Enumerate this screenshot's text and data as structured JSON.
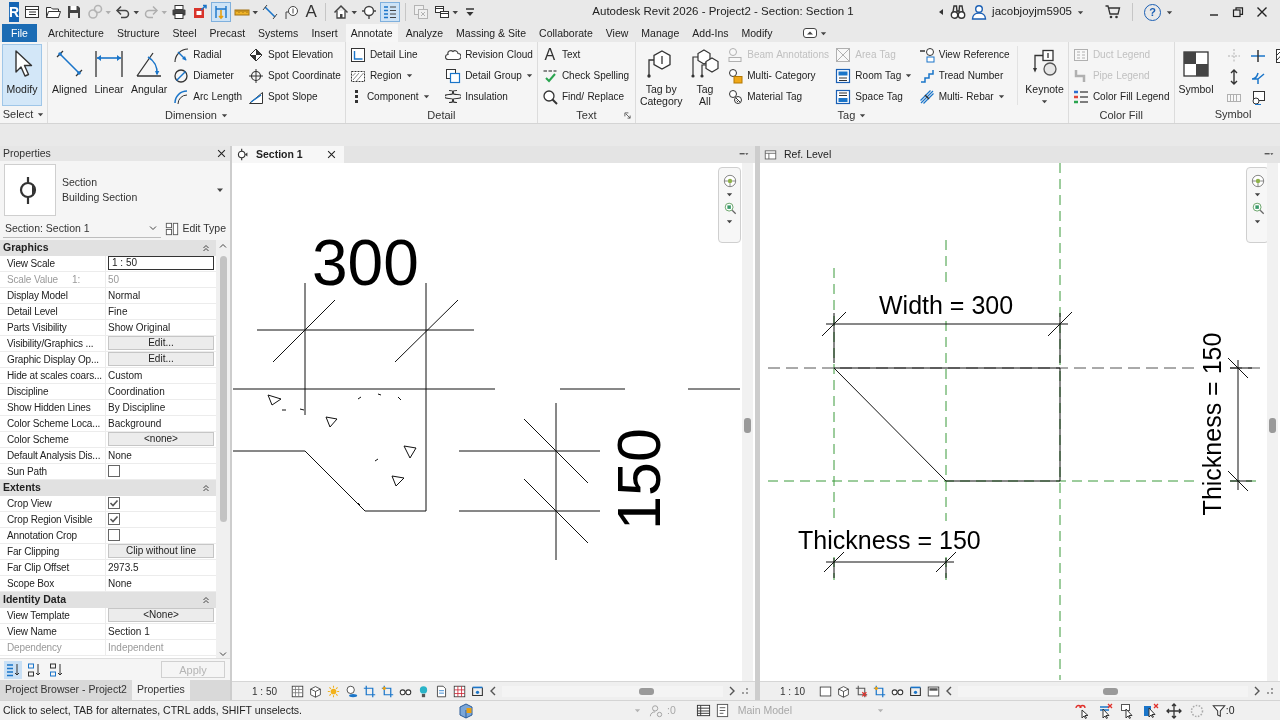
{
  "title_bar": {
    "logo": "R",
    "title": "Autodesk Revit 2026 - Project2 - Section: Section 1",
    "user": "jacobjoyjm5905",
    "help": "?"
  },
  "quick_access": {
    "tools": [
      {
        "selected": false,
        "disabled": false,
        "dropdown": false
      },
      {
        "selected": false,
        "disabled": false,
        "dropdown": false
      },
      {
        "selected": false,
        "disabled": false,
        "dropdown": false
      },
      {
        "selected": false,
        "disabled": true,
        "dropdown": true
      },
      {
        "selected": false,
        "disabled": false,
        "dropdown": true
      },
      {
        "selected": false,
        "disabled": true,
        "dropdown": true
      },
      {
        "selected": false,
        "disabled": false,
        "dropdown": false
      },
      {
        "selected": false,
        "disabled": false,
        "dropdown": false
      },
      {
        "selected": true,
        "disabled": false,
        "dropdown": false
      },
      {
        "selected": false,
        "disabled": false,
        "dropdown": true
      },
      {
        "selected": false,
        "disabled": false,
        "dropdown": false
      },
      {
        "selected": false,
        "disabled": false,
        "dropdown": false
      },
      {
        "glyph": "A",
        "selected": false,
        "disabled": false,
        "dropdown": false
      },
      {
        "selected": false,
        "disabled": false,
        "dropdown": true
      },
      {
        "selected": false,
        "disabled": false,
        "dropdown": false
      },
      {
        "selected": true,
        "disabled": false,
        "dropdown": false
      },
      {
        "selected": false,
        "disabled": true,
        "dropdown": false
      },
      {
        "selected": false,
        "disabled": false,
        "dropdown": true
      },
      {
        "selected": false,
        "disabled": false,
        "dropdown": false
      }
    ]
  },
  "menu_tabs": [
    {
      "label": "File",
      "kind": "file",
      "selected": false
    },
    {
      "label": "Architecture",
      "kind": "tab",
      "selected": false
    },
    {
      "label": "Structure",
      "kind": "tab",
      "selected": false
    },
    {
      "label": "Steel",
      "kind": "tab",
      "selected": false
    },
    {
      "label": "Precast",
      "kind": "tab",
      "selected": false
    },
    {
      "label": "Systems",
      "kind": "tab",
      "selected": false
    },
    {
      "label": "Insert",
      "kind": "tab",
      "selected": false
    },
    {
      "label": "Annotate",
      "kind": "tab",
      "selected": true
    },
    {
      "label": "Analyze",
      "kind": "tab",
      "selected": false
    },
    {
      "label": "Massing & Site",
      "kind": "tab",
      "selected": false
    },
    {
      "label": "Collaborate",
      "kind": "tab",
      "selected": false
    },
    {
      "label": "View",
      "kind": "tab",
      "selected": false
    },
    {
      "label": "Manage",
      "kind": "tab",
      "selected": false
    },
    {
      "label": "Add-Ins",
      "kind": "tab",
      "selected": false
    },
    {
      "label": "Modify",
      "kind": "tab",
      "selected": false
    }
  ],
  "ribbon": [
    {
      "title": "Select",
      "dropdown": true,
      "items": [
        {
          "label": "Modify",
          "kind": "large",
          "active": true,
          "disabled": false
        }
      ]
    },
    {
      "title": "Dimension",
      "dropdown": true,
      "items": [
        {
          "label": "Aligned",
          "kind": "large",
          "disabled": false
        },
        {
          "label": "Linear",
          "kind": "large",
          "disabled": false
        },
        {
          "label": "Angular",
          "kind": "large",
          "disabled": false
        },
        {
          "label": "Radial",
          "kind": "small",
          "disabled": false
        },
        {
          "label": "Diameter",
          "kind": "small",
          "disabled": false
        },
        {
          "label": "Arc Length",
          "kind": "small",
          "disabled": false
        },
        {
          "label": "Spot Elevation",
          "kind": "small",
          "disabled": false
        },
        {
          "label": "Spot Coordinate",
          "kind": "small",
          "disabled": false
        },
        {
          "label": "Spot Slope",
          "kind": "small",
          "disabled": false
        }
      ]
    },
    {
      "title": "Detail",
      "items": [
        {
          "label": "Detail Line",
          "kind": "small",
          "disabled": false
        },
        {
          "label": "Region",
          "kind": "small",
          "dropdown": true,
          "disabled": false
        },
        {
          "label": "Component",
          "kind": "small",
          "dropdown": true,
          "disabled": false
        },
        {
          "label": "Revision Cloud",
          "kind": "small",
          "disabled": false
        },
        {
          "label": "Detail Group",
          "kind": "small",
          "dropdown": true,
          "disabled": false
        },
        {
          "label": "Insulation",
          "kind": "small",
          "disabled": false
        }
      ]
    },
    {
      "title": "Text",
      "launcher": true,
      "items": [
        {
          "label": "Text",
          "kind": "small",
          "glyph": "A",
          "disabled": false
        },
        {
          "label": "Check Spelling",
          "kind": "small",
          "disabled": false
        },
        {
          "label": "Find/ Replace",
          "kind": "small",
          "disabled": false
        }
      ]
    },
    {
      "title": "Tag",
      "dropdown": true,
      "items": [
        {
          "label": "Tag by\nCategory",
          "kind": "large",
          "disabled": false
        },
        {
          "label": "Tag\nAll",
          "kind": "large",
          "disabled": false
        },
        {
          "label": "Beam Annotations",
          "kind": "small",
          "disabled": true
        },
        {
          "label": "Multi- Category",
          "kind": "small",
          "disabled": false
        },
        {
          "label": "Material Tag",
          "kind": "small",
          "disabled": false
        },
        {
          "label": "Area Tag",
          "kind": "small",
          "disabled": true
        },
        {
          "label": "Room Tag",
          "kind": "small",
          "dropdown": true,
          "disabled": false
        },
        {
          "label": "Space Tag",
          "kind": "small",
          "disabled": false
        },
        {
          "label": "View Reference",
          "kind": "small",
          "disabled": false
        },
        {
          "label": "Tread Number",
          "kind": "small",
          "disabled": false
        },
        {
          "label": "Multi- Rebar",
          "kind": "small",
          "dropdown": true,
          "disabled": false
        },
        {
          "label": "Keynote",
          "kind": "large",
          "dropdown": true,
          "disabled": false
        }
      ]
    },
    {
      "title": "Color Fill",
      "items": [
        {
          "label": "Duct Legend",
          "kind": "small",
          "disabled": true
        },
        {
          "label": "Pipe Legend",
          "kind": "small",
          "disabled": true
        },
        {
          "label": "Color Fill Legend",
          "kind": "small",
          "disabled": false
        }
      ]
    },
    {
      "title": "Symbol",
      "items": [
        {
          "label": "Symbol",
          "kind": "large",
          "disabled": false
        }
      ],
      "tools": [
        {
          "disabled": true
        },
        {
          "disabled": false
        },
        {
          "disabled": false
        },
        {
          "disabled": false
        },
        {
          "disabled": false
        },
        {
          "disabled": true
        },
        {
          "disabled": false
        }
      ]
    }
  ],
  "properties": {
    "title": "Properties",
    "type_family": "Section",
    "type_name": "Building Section",
    "instance": "Section: Section 1",
    "edit_type": "Edit Type",
    "groups": [
      {
        "title": "Graphics",
        "expanded": true,
        "rows": [
          {
            "name": "View Scale",
            "value": "1 : 50",
            "kind": "input",
            "disabled": false
          },
          {
            "name": "Scale Value",
            "unit": "1:",
            "value": "50",
            "kind": "text",
            "disabled": true
          },
          {
            "name": "Display Model",
            "value": "Normal",
            "kind": "text",
            "disabled": false
          },
          {
            "name": "Detail Level",
            "value": "Fine",
            "kind": "text",
            "disabled": false
          },
          {
            "name": "Parts Visibility",
            "value": "Show Original",
            "kind": "text",
            "disabled": false
          },
          {
            "name": "Visibility/Graphics ...",
            "value": "Edit...",
            "kind": "button",
            "disabled": false
          },
          {
            "name": "Graphic Display Op...",
            "value": "Edit...",
            "kind": "button",
            "disabled": false
          },
          {
            "name": "Hide at scales coars...",
            "value": "Custom",
            "kind": "text",
            "disabled": false
          },
          {
            "name": "Discipline",
            "value": "Coordination",
            "kind": "text",
            "disabled": false
          },
          {
            "name": "Show Hidden Lines",
            "value": "By Discipline",
            "kind": "text",
            "disabled": false
          },
          {
            "name": "Color Scheme Loca...",
            "value": "Background",
            "kind": "text",
            "disabled": false
          },
          {
            "name": "Color Scheme",
            "value": "<none>",
            "kind": "button",
            "disabled": false
          },
          {
            "name": "Default Analysis Dis...",
            "value": "None",
            "kind": "text",
            "disabled": false
          },
          {
            "name": "Sun Path",
            "kind": "checkbox",
            "checked": false,
            "disabled": false
          }
        ]
      },
      {
        "title": "Extents",
        "expanded": true,
        "rows": [
          {
            "name": "Crop View",
            "kind": "checkbox",
            "checked": true,
            "disabled": false
          },
          {
            "name": "Crop Region Visible",
            "kind": "checkbox",
            "checked": true,
            "disabled": false
          },
          {
            "name": "Annotation Crop",
            "kind": "checkbox",
            "checked": false,
            "disabled": false
          },
          {
            "name": "Far Clipping",
            "value": "Clip without line",
            "kind": "button",
            "disabled": false
          },
          {
            "name": "Far Clip Offset",
            "value": "2973.5",
            "kind": "text",
            "disabled": false
          },
          {
            "name": "Scope Box",
            "value": "None",
            "kind": "text",
            "disabled": false
          }
        ]
      },
      {
        "title": "Identity Data",
        "expanded": true,
        "rows": [
          {
            "name": "View Template",
            "value": "<None>",
            "kind": "button",
            "disabled": false
          },
          {
            "name": "View Name",
            "value": "Section 1",
            "kind": "text",
            "disabled": false
          },
          {
            "name": "Dependency",
            "value": "Independent",
            "kind": "text",
            "disabled": true
          }
        ]
      }
    ],
    "sort_modes": [
      {
        "selected": true
      },
      {
        "selected": false
      },
      {
        "selected": false
      }
    ],
    "apply": {
      "label": "Apply",
      "disabled": true
    },
    "tabs": [
      {
        "label": "Project Browser - Project2",
        "selected": false
      },
      {
        "label": "Properties",
        "selected": true
      }
    ]
  },
  "views": [
    {
      "title": "Section 1",
      "active": true,
      "closable": true,
      "scale": "1 : 50",
      "labels": [
        {
          "text": "300",
          "kind": "horizontal"
        },
        {
          "text": "150",
          "kind": "vertical"
        }
      ]
    },
    {
      "title": "Ref. Level",
      "active": false,
      "closable": false,
      "scale": "1 : 10",
      "labels": [
        {
          "text": "Width = 300",
          "kind": "horizontal"
        },
        {
          "text": "Thickness = 150",
          "kind": "vertical"
        },
        {
          "text": "Thickness = 150",
          "kind": "horizontal"
        }
      ]
    }
  ],
  "status_bar": {
    "message": "Click to select, TAB for alternates, CTRL adds, SHIFT unselects.",
    "counter": ":0",
    "design_option": {
      "label": "Main Model",
      "disabled": true
    },
    "filter_count": ":0"
  }
}
